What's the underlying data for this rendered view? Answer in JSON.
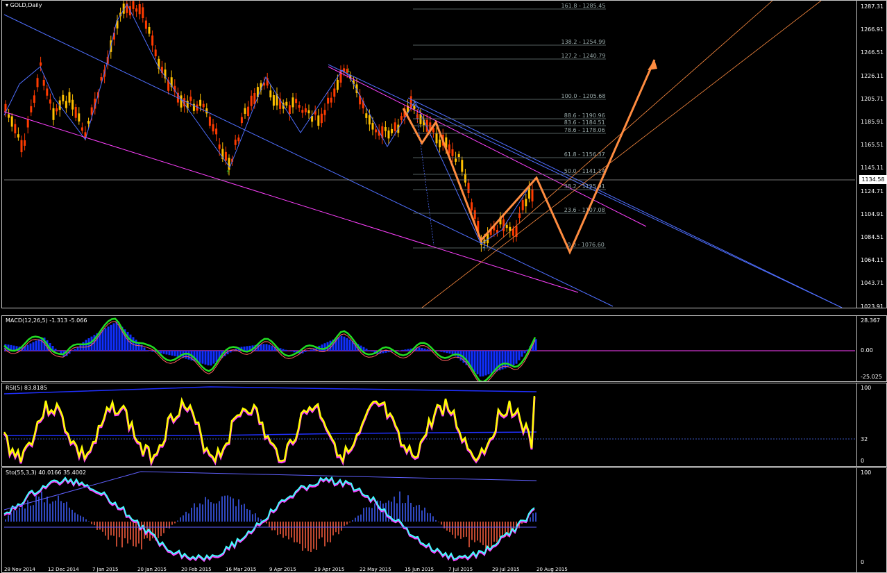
{
  "symbol_label": "GOLD,Daily",
  "current_price": "1134.58",
  "price_axis": [
    "1287.31",
    "1266.91",
    "1246.51",
    "1226.11",
    "1205.71",
    "1185.91",
    "1165.51",
    "1145.11",
    "1124.71",
    "1104.91",
    "1084.51",
    "1064.11",
    "1043.71",
    "1023.91"
  ],
  "fib_levels": [
    "161.8 - 1285.45",
    "138.2 - 1254.99",
    "127.2 - 1240.79",
    "100.0 - 1205.68",
    "88.6 - 1190.96",
    "83.6 - 1184.51",
    "78.6 - 1178.06",
    "61.8 - 1156.37",
    "50.0 - 1141.14",
    "38.2 - 1125.91",
    "23.6 - 1107.08",
    "0.0 - 1076.60"
  ],
  "macd": {
    "label": "MACD(12,26,5) -1.313 -5.066",
    "axis": [
      "28.367",
      "0.00",
      "-25.025"
    ]
  },
  "rsi": {
    "label": "RSI(5) 83.8185",
    "axis": [
      "100",
      "32",
      "0"
    ]
  },
  "sto": {
    "label": "Sto(55,3,3) 40.0166 35.4002",
    "axis": [
      "100",
      "0"
    ]
  },
  "date_axis": [
    "28 Nov 2014",
    "12 Dec 2014",
    "7 Jan 2015",
    "20 Jan 2015",
    "20 Feb 2015",
    "16 Mar 2015",
    "9 Apr 2015",
    "29 Apr 2015",
    "22 May 2015",
    "15 Jun 2015",
    "7 Jul 2015",
    "29 Jul 2015",
    "20 Aug 2015"
  ],
  "colors": {
    "bull": "#ffc000",
    "bear": "#ff3b00",
    "accent": "#ff8c40",
    "channel": "#4f6fff",
    "magenta": "#ff40ff"
  }
}
